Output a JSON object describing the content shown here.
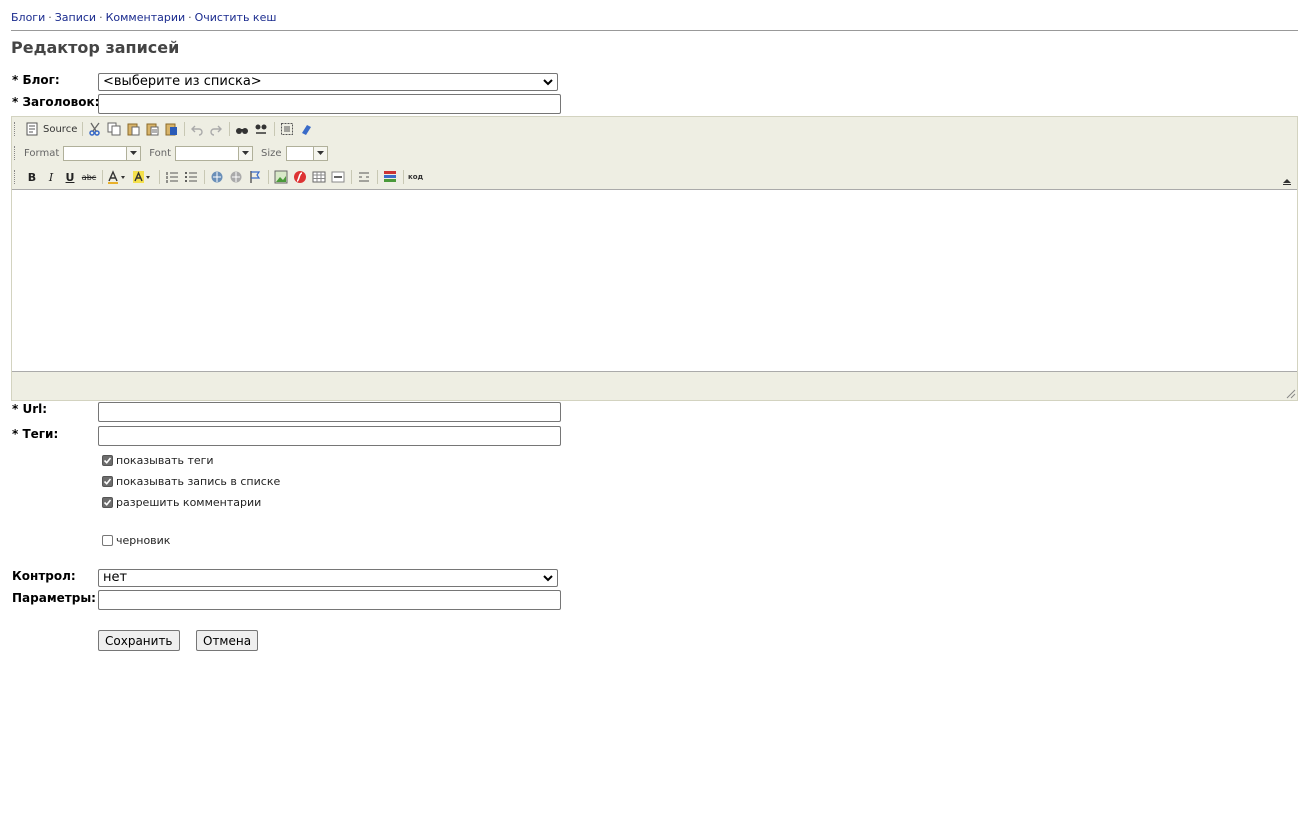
{
  "nav": {
    "items": [
      "Блоги",
      "Записи",
      "Комментарии",
      "Очистить кеш"
    ],
    "separator": "·"
  },
  "page_title": "Редактор записей",
  "form": {
    "blog_label": "* Блог:",
    "blog_value": "<выберите из списка>",
    "title_label": "* Заголовок:",
    "title_value": "",
    "url_label": "* Url:",
    "url_value": "",
    "tags_label": "* Теги:",
    "tags_value": "",
    "checkboxes": [
      {
        "label": "показывать теги",
        "checked": true
      },
      {
        "label": "показывать запись в списке",
        "checked": true
      },
      {
        "label": "разрешить комментарии",
        "checked": true
      },
      {
        "label": "черновик",
        "checked": false
      }
    ],
    "control_label": "Контрол:",
    "control_value": "нет",
    "params_label": "Параметры:",
    "params_value": "",
    "save_label": "Сохранить",
    "cancel_label": "Отмена"
  },
  "editor": {
    "source_label": "Source",
    "format_label": "Format",
    "font_label": "Font",
    "size_label": "Size",
    "bold": "B",
    "italic": "I",
    "underline": "U",
    "strike": "abc",
    "code_label": "код",
    "content": ""
  },
  "colors": {
    "link": "#1a2b8e",
    "title": "#444444",
    "editor_chrome": "#eeeee3"
  }
}
